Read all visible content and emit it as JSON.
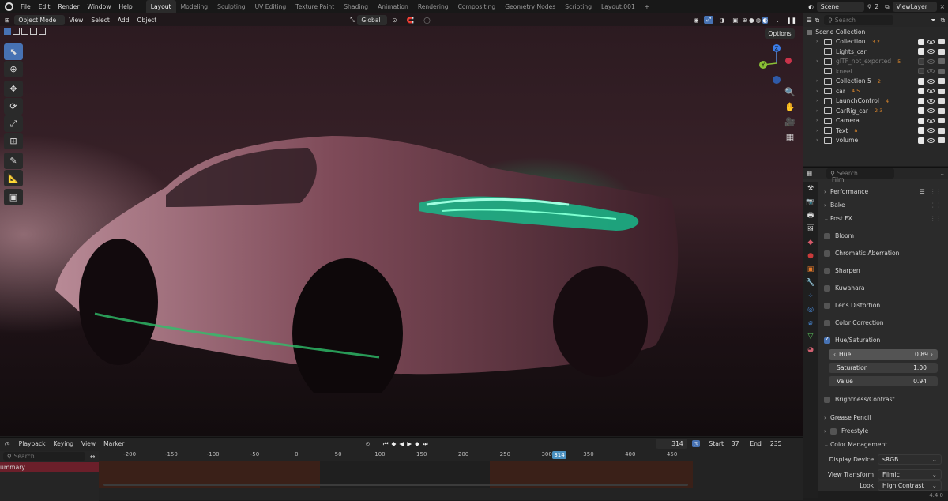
{
  "menu": {
    "items": [
      "File",
      "Edit",
      "Render",
      "Window",
      "Help"
    ],
    "workspaces": [
      "Layout",
      "Modeling",
      "Sculpting",
      "UV Editing",
      "Texture Paint",
      "Shading",
      "Animation",
      "Rendering",
      "Compositing",
      "Geometry Nodes",
      "Scripting",
      "Layout.001"
    ],
    "active_workspace": "Layout",
    "add_tab": "+",
    "scene": "Scene",
    "scene_count": "2",
    "view_layer": "ViewLayer"
  },
  "viewport": {
    "mode": "Object Mode",
    "menus": [
      "View",
      "Select",
      "Add",
      "Object"
    ],
    "transform_orientation": "Global",
    "options_label": "Options",
    "gizmo_labels": {
      "y": "Y",
      "z": "Z"
    }
  },
  "outliner": {
    "search_placeholder": "Search",
    "root": "Scene Collection",
    "items": [
      {
        "label": "Collection",
        "dim": false,
        "badge": "3  2"
      },
      {
        "label": "Lights_car",
        "dim": false,
        "badge": ""
      },
      {
        "label": "glTF_not_exported",
        "dim": true,
        "badge": "5"
      },
      {
        "label": "kneel",
        "dim": true,
        "badge": ""
      },
      {
        "label": "Collection 5",
        "dim": false,
        "badge": "2"
      },
      {
        "label": "car",
        "dim": false,
        "badge": "4  5"
      },
      {
        "label": "LaunchControl",
        "dim": false,
        "badge": "4"
      },
      {
        "label": "CarRig_car",
        "dim": false,
        "badge": "2  3"
      },
      {
        "label": "Camera",
        "dim": false,
        "badge": ""
      },
      {
        "label": "Text",
        "dim": false,
        "badge": "a"
      },
      {
        "label": "volume",
        "dim": false,
        "badge": ""
      }
    ]
  },
  "properties": {
    "search_placeholder": "Search",
    "cut_label": "Film",
    "panels": {
      "performance": "Performance",
      "bake": "Bake",
      "post_fx": "Post FX",
      "bloom": "Bloom",
      "chromatic": "Chromatic Aberration",
      "sharpen": "Sharpen",
      "kuwahara": "Kuwahara",
      "lens": "Lens Distortion",
      "color_correction": "Color Correction",
      "hue_sat": "Hue/Saturation",
      "brightness": "Brightness/Contrast",
      "grease": "Grease Pencil",
      "freestyle": "Freestyle",
      "color_mgmt": "Color Management"
    },
    "hue": {
      "label": "Hue",
      "value": "0.89"
    },
    "saturation": {
      "label": "Saturation",
      "value": "1.00"
    },
    "value": {
      "label": "Value",
      "value": "0.94"
    },
    "display_device": {
      "label": "Display Device",
      "value": "sRGB"
    },
    "view_transform": {
      "label": "View Transform",
      "value": "Filmic"
    },
    "look": {
      "label": "Look",
      "value": "High Contrast"
    }
  },
  "timeline": {
    "menus": [
      "Playback",
      "Keying",
      "View",
      "Marker"
    ],
    "current_frame": "314",
    "start_label": "Start",
    "start": "37",
    "end_label": "End",
    "end": "235",
    "search_placeholder": "Search",
    "channel": "ummary",
    "ticks": [
      "-200",
      "-150",
      "-100",
      "-50",
      "0",
      "50",
      "100",
      "150",
      "200",
      "250",
      "300",
      "350",
      "400",
      "450"
    ],
    "playhead": "314"
  },
  "version": "4.4.0",
  "colors": {
    "accent": "#4772b3",
    "selected_blue": "#5680c2",
    "playhead": "#4a90c0"
  }
}
